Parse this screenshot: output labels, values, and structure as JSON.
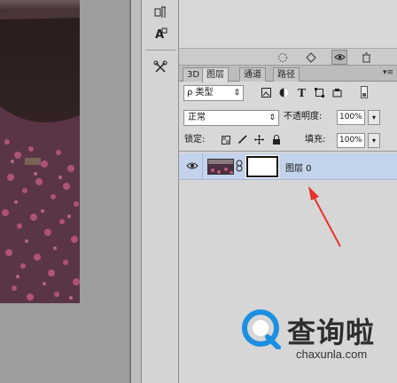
{
  "tool_column": {
    "icons": [
      "paragraph-tool-icon",
      "character-style-icon",
      "scissors-tool-icon"
    ]
  },
  "top_strip": {
    "icons": [
      "dotted-circle-icon",
      "diamond-icon",
      "eye-toggle-icon",
      "trash-icon"
    ]
  },
  "layers_panel": {
    "tabs": [
      {
        "label": "3D",
        "active": false
      },
      {
        "label": "图层",
        "active": true
      },
      {
        "label": "通道",
        "active": false
      },
      {
        "label": "路径",
        "active": false
      }
    ],
    "filter": {
      "label": "ρ 类型",
      "icons": [
        "image-filter-icon",
        "adjustment-filter-icon",
        "text-filter-icon",
        "shape-filter-icon",
        "smart-object-filter-icon",
        "filter-toggle-icon"
      ]
    },
    "blend_mode": "正常",
    "opacity_label": "不透明度:",
    "opacity_value": "100%",
    "lock_label": "锁定:",
    "lock_icons": [
      "lock-transparent-icon",
      "lock-paint-icon",
      "lock-position-icon",
      "lock-all-icon"
    ],
    "fill_label": "填充:",
    "fill_value": "100%",
    "layers": [
      {
        "name": "图层 0",
        "visible": true,
        "selected": true,
        "has_mask": true
      }
    ]
  },
  "watermark": {
    "brand_text": "查询啦",
    "url": "chaxunla.com"
  },
  "colors": {
    "selected_row": "#c3d3ec",
    "panel_bg": "#d8d8d8",
    "annotation_arrow": "#e8322c",
    "watermark_blue": "#1b8fe0"
  }
}
